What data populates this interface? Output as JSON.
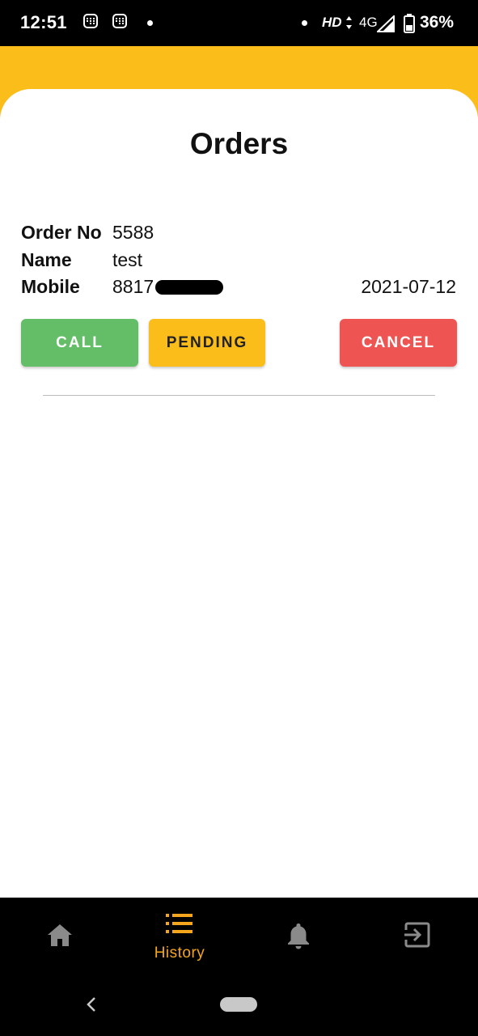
{
  "status_bar": {
    "time": "12:51",
    "hd": "HD",
    "network": "4G",
    "battery": "36%",
    "icons": [
      "sim-card-icon",
      "sim-card-icon",
      "notification-dot-icon",
      "dot-icon",
      "data-arrows-icon",
      "signal-icon",
      "battery-icon"
    ]
  },
  "page": {
    "title": "Orders"
  },
  "order": {
    "order_no_label": "Order No",
    "order_no": "5588",
    "name_label": "Name",
    "name": "test",
    "mobile_label": "Mobile",
    "mobile": "8817",
    "date": "2021-07-12"
  },
  "actions": {
    "call": "CALL",
    "pending": "PENDING",
    "cancel": "CANCEL"
  },
  "colors": {
    "accent_yellow": "#FBBD1A",
    "call_green": "#63BE67",
    "cancel_red": "#EE5552",
    "active_nav": "#F4A71D"
  },
  "bottom_nav": {
    "items": [
      {
        "icon": "home-icon",
        "label": "",
        "active": false
      },
      {
        "icon": "list-icon",
        "label": "History",
        "active": true
      },
      {
        "icon": "bell-icon",
        "label": "",
        "active": false
      },
      {
        "icon": "logout-icon",
        "label": "",
        "active": false
      }
    ]
  },
  "system_nav": {
    "icons": [
      "back-icon",
      "home-pill"
    ]
  }
}
